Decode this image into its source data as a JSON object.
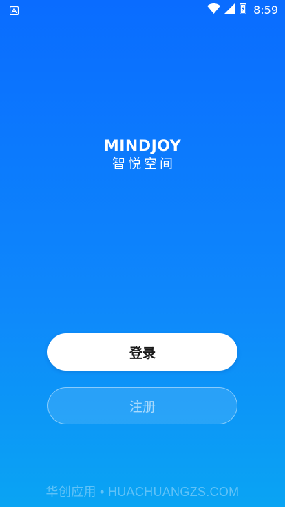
{
  "status_bar": {
    "left_icon": "android-notification-icon",
    "wifi_icon": "wifi-icon",
    "signal_icon": "cell-signal-icon",
    "battery_icon": "battery-icon",
    "time": "8:59"
  },
  "brand": {
    "name": "MINDJOY",
    "name_cn": "智悦空间"
  },
  "actions": {
    "login_label": "登录",
    "register_label": "注册"
  },
  "watermark": {
    "text": "华创应用 • HUACHUANGZS.COM"
  },
  "colors": {
    "background_top": "#0a6cff",
    "background_bottom": "#0aa4f3",
    "login_bg": "#ffffff",
    "login_text": "#1a1a1a",
    "register_text": "rgba(255,255,255,0.6)"
  }
}
